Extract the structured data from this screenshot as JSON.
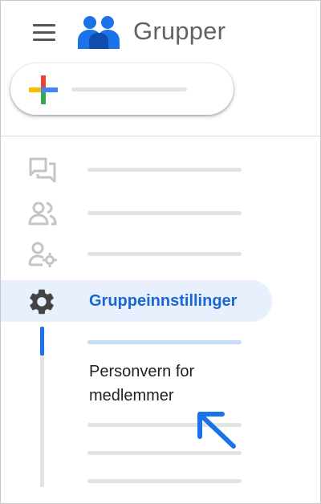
{
  "header": {
    "app_title": "Grupper",
    "menu_icon": "hamburger-menu-icon",
    "logo_icon": "groups-people-icon"
  },
  "create_button": {
    "icon": "plus-multicolor-icon"
  },
  "nav": {
    "items": [
      {
        "icon": "conversations-icon"
      },
      {
        "icon": "people-icon"
      },
      {
        "icon": "person-settings-icon"
      }
    ],
    "active": {
      "icon": "gear-icon",
      "label": "Gruppeinnstillinger"
    }
  },
  "settings_subnav": {
    "current_item": "Personvern for medlemmer",
    "pointer_icon": "arrow-pointer-icon"
  },
  "colors": {
    "accent": "#1a73e8",
    "accent_text": "#1967d2",
    "active_bg": "#e8f0fe",
    "logo_blue": "#1a73e8",
    "plus_blue": "#4285f4",
    "plus_red": "#ea4335",
    "plus_yellow": "#fbbc04",
    "plus_green": "#34a853",
    "icon_gray": "#5f6368",
    "placeholder_gray": "#e3e3e3"
  }
}
